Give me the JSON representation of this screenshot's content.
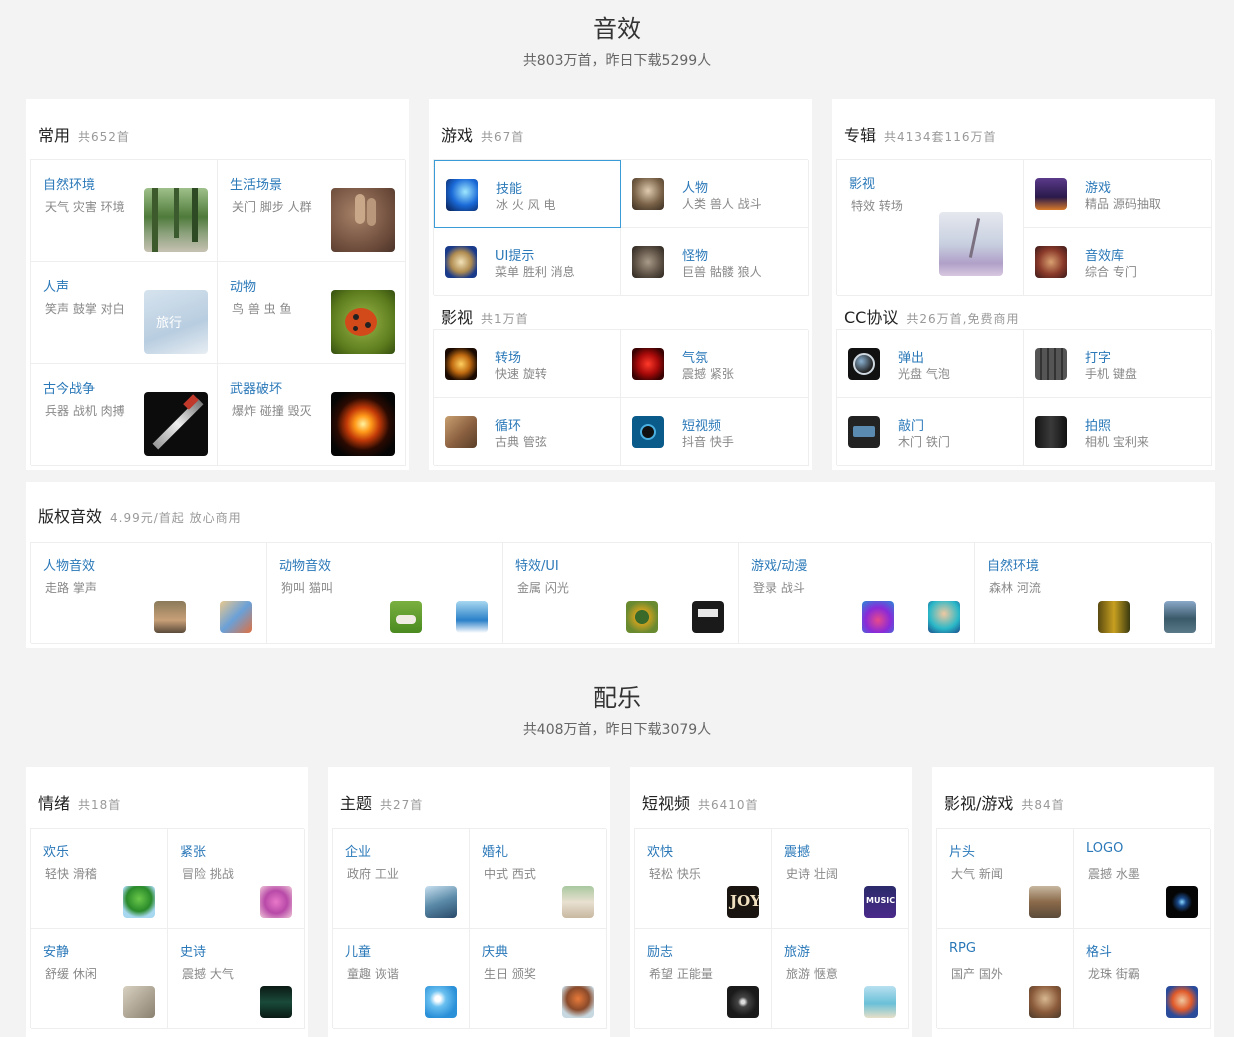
{
  "sfx": {
    "title": "音效",
    "subtitle": "共803万首，昨日下载5299人"
  },
  "music": {
    "title": "配乐",
    "subtitle": "共408万首，昨日下载3079人"
  },
  "common": {
    "title": "常用",
    "count": "共652首",
    "items": [
      {
        "name": "自然环境",
        "desc": "天气 灾害 环境",
        "icon": "forest-path-thumb"
      },
      {
        "name": "生活场景",
        "desc": "关门 脚步 人群",
        "icon": "footprints-sand-thumb"
      },
      {
        "name": "人声",
        "desc": "笑声 鼓掌 对白",
        "icon": "travel-cloud-thumb"
      },
      {
        "name": "动物",
        "desc": "鸟 兽 虫 鱼",
        "icon": "ladybug-thumb"
      },
      {
        "name": "古今战争",
        "desc": "兵器 战机 肉搏",
        "icon": "sword-thumb"
      },
      {
        "name": "武器破坏",
        "desc": "爆炸 碰撞 毁灭",
        "icon": "explosion-thumb"
      }
    ]
  },
  "game": {
    "title": "游戏",
    "count": "共67首",
    "items": [
      {
        "name": "技能",
        "desc": "冰 火 风 电",
        "icon": "skill-blue-icon"
      },
      {
        "name": "人物",
        "desc": "人类 兽人 战斗",
        "icon": "warrior-icon"
      },
      {
        "name": "UI提示",
        "desc": "菜单 胜利 消息",
        "icon": "ui-house-icon"
      },
      {
        "name": "怪物",
        "desc": "巨兽 骷髅 狼人",
        "icon": "monster-icon"
      }
    ]
  },
  "film": {
    "title": "影视",
    "count": "共1万首",
    "items": [
      {
        "name": "转场",
        "desc": "快速 旋转",
        "icon": "sparkle-icon"
      },
      {
        "name": "气氛",
        "desc": "震撼 紧张",
        "icon": "heart-icon"
      },
      {
        "name": "循环",
        "desc": "古典 管弦",
        "icon": "book-icon"
      },
      {
        "name": "短视频",
        "desc": "抖音 快手",
        "icon": "record-icon"
      }
    ]
  },
  "album": {
    "title": "专辑",
    "count": "共4134套116万首",
    "items": [
      {
        "name": "影视",
        "desc": "特效 转场",
        "icon": "misty-landscape-thumb"
      },
      {
        "name": "游戏",
        "desc": "精品 源码抽取",
        "icon": "game-art-icon"
      },
      {
        "name": "音效库",
        "desc": "综合 专门",
        "icon": "sfx-library-icon"
      }
    ]
  },
  "cc": {
    "title": "CC协议",
    "count": "共26万首,免费商用",
    "items": [
      {
        "name": "弹出",
        "desc": "光盘 气泡",
        "icon": "bubble-icon"
      },
      {
        "name": "打字",
        "desc": "手机 键盘",
        "icon": "keyboard-icon"
      },
      {
        "name": "敲门",
        "desc": "木门 铁门",
        "icon": "door-icon"
      },
      {
        "name": "拍照",
        "desc": "相机 宝利来",
        "icon": "camera-icon"
      }
    ]
  },
  "copyright": {
    "title": "版权音效",
    "count": "4.99元/首起 放心商用",
    "items": [
      {
        "name": "人物音效",
        "desc": "走路 掌声",
        "icons": [
          "hiker-icon",
          "art-icon"
        ]
      },
      {
        "name": "动物音效",
        "desc": "狗叫 猫叫",
        "icons": [
          "dog-icon",
          "dolphin-icon"
        ]
      },
      {
        "name": "特效/UI",
        "desc": "金属 闪光",
        "icons": [
          "chip-icon",
          "device-icon"
        ]
      },
      {
        "name": "游戏/动漫",
        "desc": "登录 战斗",
        "icons": [
          "cartoon-icon",
          "character-icon"
        ]
      },
      {
        "name": "自然环境",
        "desc": "森林 河流",
        "icons": [
          "forest-icon",
          "lake-icon"
        ]
      }
    ]
  },
  "mood": {
    "title": "情绪",
    "count": "共18首",
    "items": [
      {
        "name": "欢乐",
        "desc": "轻快 滑稽",
        "icon": "tree-icon"
      },
      {
        "name": "紧张",
        "desc": "冒险 挑战",
        "icon": "pink-figure-icon"
      },
      {
        "name": "安静",
        "desc": "舒缓 休闲",
        "icon": "love-icon"
      },
      {
        "name": "史诗",
        "desc": "震撼 大气",
        "icon": "sparks-icon"
      }
    ]
  },
  "theme": {
    "title": "主题",
    "count": "共27首",
    "items": [
      {
        "name": "企业",
        "desc": "政府 工业",
        "icon": "building-icon"
      },
      {
        "name": "婚礼",
        "desc": "中式 西式",
        "icon": "heart-sand-icon"
      },
      {
        "name": "儿童",
        "desc": "童趣 诙谐",
        "icon": "cartoon-sky-icon"
      },
      {
        "name": "庆典",
        "desc": "生日 颁奖",
        "icon": "balloon-icon"
      }
    ]
  },
  "short": {
    "title": "短视频",
    "count": "共6410首",
    "items": [
      {
        "name": "欢快",
        "desc": "轻松 快乐",
        "icon": "joy-icon"
      },
      {
        "name": "震撼",
        "desc": "史诗 壮阔",
        "icon": "music-poster-icon"
      },
      {
        "name": "励志",
        "desc": "希望 正能量",
        "icon": "gear-art-icon"
      },
      {
        "name": "旅游",
        "desc": "旅游 惬意",
        "icon": "beach-icon"
      }
    ]
  },
  "fg": {
    "title": "影视/游戏",
    "count": "共84首",
    "items": [
      {
        "name": "片头",
        "desc": "大气 新闻",
        "icon": "mountain-icon"
      },
      {
        "name": "LOGO",
        "desc": "震撼 水墨",
        "icon": "glow-icon"
      },
      {
        "name": "RPG",
        "desc": "国产 国外",
        "icon": "rpg-icon"
      },
      {
        "name": "格斗",
        "desc": "龙珠 街霸",
        "icon": "fighter-icon"
      }
    ]
  }
}
